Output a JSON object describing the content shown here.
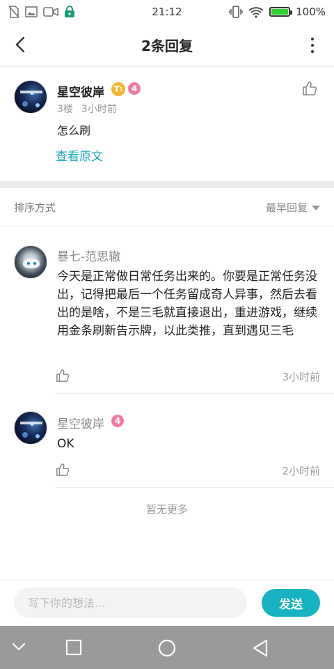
{
  "status_bar": {
    "time": "21:12",
    "battery": "100%",
    "icons": [
      "no-sim-icon",
      "image-icon",
      "video-icon",
      "lock-icon",
      "vibrate-icon",
      "wifi-icon",
      "battery-icon"
    ]
  },
  "header": {
    "title": "2条回复",
    "icons": [
      "back-arrow-icon",
      "more-vertical-icon"
    ]
  },
  "original_post": {
    "username": "星空彼岸",
    "badge_letter": "T",
    "badge_sub": "1",
    "level": "4",
    "floor": "3楼",
    "time": "3小时前",
    "content": "怎么刷",
    "view_original": "查看原文"
  },
  "sort": {
    "label": "排序方式",
    "selected": "最早回复"
  },
  "replies": [
    {
      "username": "暴七-范思辙",
      "content": "今天是正常做日常任务出来的。你要是正常任务没出，记得把最后一个任务留成奇人异事，然后去看出的是啥，不是三毛就直接退出，重进游戏，继续用金条刷新告示牌，以此类推，直到遇见三毛",
      "time": "3小时前"
    },
    {
      "username": "星空彼岸",
      "level": "4",
      "content": "OK",
      "time": "2小时前"
    }
  ],
  "no_more": "暂无更多",
  "input": {
    "placeholder": "写下你的想法...",
    "send_label": "发送"
  },
  "colors": {
    "accent": "#17b3c2",
    "link": "#1aa7bd",
    "level_badge": "#f27aa5",
    "title_badge": "#f2b632",
    "nav_bar": "#9a9a9a"
  }
}
